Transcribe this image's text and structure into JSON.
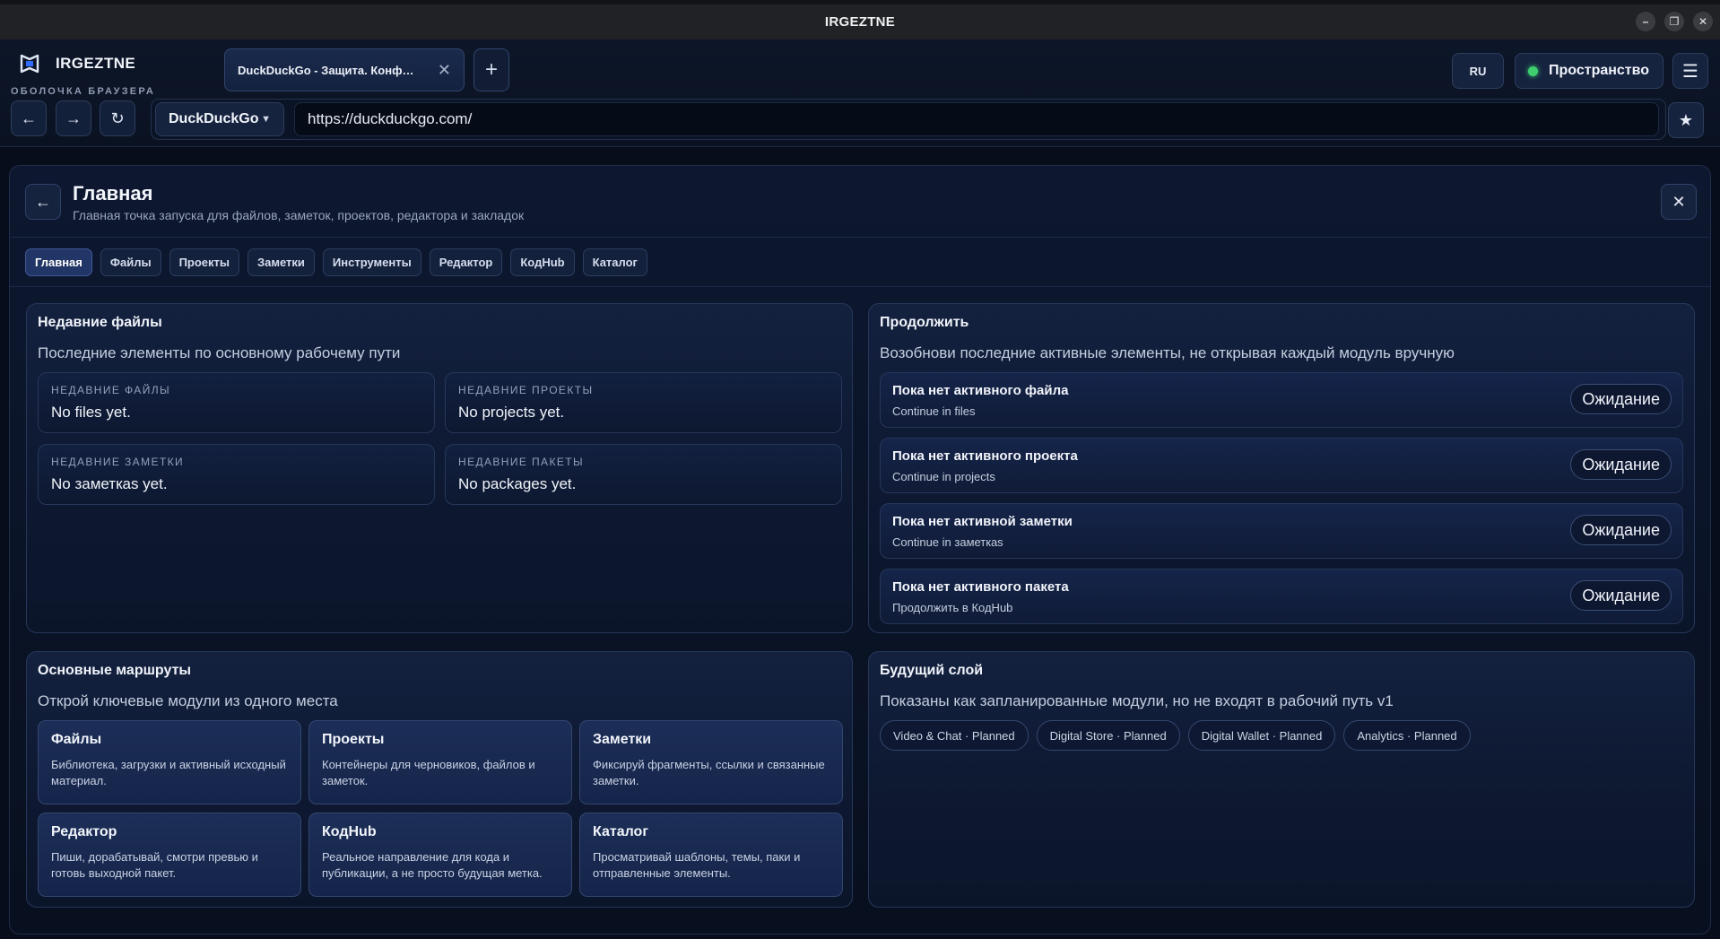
{
  "window": {
    "title": "IRGEZTNE",
    "controls": [
      "–",
      "❐",
      "✕"
    ]
  },
  "browser": {
    "brand": "IRGEZTNE",
    "shell_label": "ОБОЛОЧКА БРАУЗЕРА",
    "tab": {
      "label": "DuckDuckGo - Защита. Конф…",
      "close": "✕"
    },
    "new_tab": "+",
    "nav": {
      "back": "←",
      "forward": "→",
      "reload": "↻"
    },
    "engine": {
      "label": "DuckDuckGo",
      "caret": "▼"
    },
    "address": "https://duckduckgo.com/",
    "bookmark": "★",
    "lang": "RU",
    "space": "Пространство",
    "menu": "☰"
  },
  "panel": {
    "back": "←",
    "close": "✕",
    "title": "Главная",
    "subtitle": "Главная точка запуска для файлов, заметок, проектов, редактора и закладок",
    "tabs": [
      "Главная",
      "Файлы",
      "Проекты",
      "Заметки",
      "Инструменты",
      "Редактор",
      "КодHub",
      "Каталог"
    ]
  },
  "recent": {
    "title": "Недавние файлы",
    "subtitle": "Последние элементы по основному рабочему пути",
    "tiles": [
      {
        "label": "НЕДАВНИЕ ФАЙЛЫ",
        "value": "No files yet."
      },
      {
        "label": "НЕДАВНИЕ ПРОЕКТЫ",
        "value": "No projects yet."
      },
      {
        "label": "НЕДАВНИЕ ЗАМЕТКИ",
        "value": "No заметкas yet."
      },
      {
        "label": "НЕДАВНИЕ ПАКЕТЫ",
        "value": "No packages yet."
      }
    ]
  },
  "continue": {
    "title": "Продолжить",
    "subtitle": "Возобнови последние активные элементы, не открывая каждый модуль вручную",
    "items": [
      {
        "title": "Пока нет активного файла",
        "sub": "Continue in files",
        "badge": "Ожидание"
      },
      {
        "title": "Пока нет активного проекта",
        "sub": "Continue in projects",
        "badge": "Ожидание"
      },
      {
        "title": "Пока нет активной заметки",
        "sub": "Continue in заметкas",
        "badge": "Ожидание"
      },
      {
        "title": "Пока нет активного пакета",
        "sub": "Продолжить в КодHub",
        "badge": "Ожидание"
      }
    ]
  },
  "routes": {
    "title": "Основные маршруты",
    "subtitle": "Открой ключевые модули из одного места",
    "items": [
      {
        "title": "Файлы",
        "desc": "Библиотека, загрузки и активный исходный материал."
      },
      {
        "title": "Проекты",
        "desc": "Контейнеры для черновиков, файлов и заметок."
      },
      {
        "title": "Заметки",
        "desc": "Фиксируй фрагменты, ссылки и связанные заметки."
      },
      {
        "title": "Редактор",
        "desc": "Пиши, дорабатывай, смотри превью и готовь выходной пакет."
      },
      {
        "title": "КодHub",
        "desc": "Реальное направление для кода и публикации, а не просто будущая метка."
      },
      {
        "title": "Каталог",
        "desc": "Просматривай шаблоны, темы, паки и отправленные элементы."
      }
    ]
  },
  "future": {
    "title": "Будущий слой",
    "subtitle": "Показаны как запланированные модули, но не входят в рабочий путь v1",
    "pills": [
      "Video & Chat · Planned",
      "Digital Store · Planned",
      "Digital Wallet · Planned",
      "Analytics · Planned"
    ]
  }
}
